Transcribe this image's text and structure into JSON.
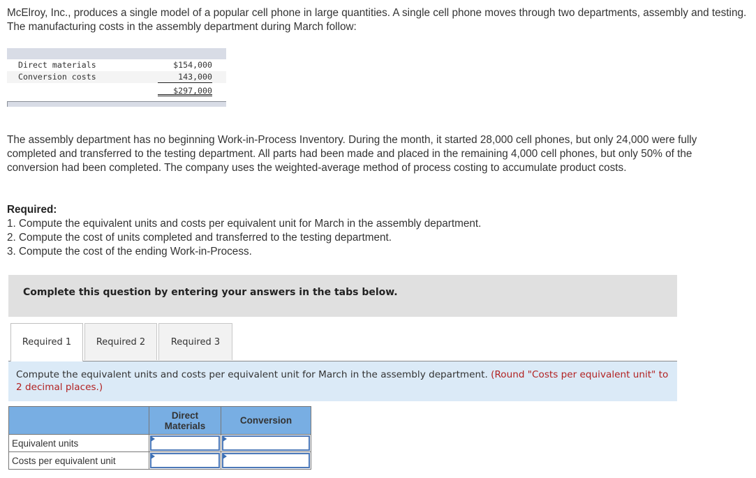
{
  "intro": {
    "text": "McElroy, Inc., produces a single model of a popular cell phone in large quantities. A single cell phone moves through two departments, assembly and testing. The manufacturing costs in the assembly department during March follow:"
  },
  "cost_table": {
    "rows": [
      {
        "label": "Direct materials",
        "value": "$154,000"
      },
      {
        "label": "Conversion costs",
        "value": "143,000"
      }
    ],
    "total": "$297,000"
  },
  "paragraph2": {
    "text": "The assembly department has no beginning Work-in-Process Inventory. During the month, it started 28,000 cell phones, but only 24,000 were fully completed and transferred to the testing department. All parts had been made and placed in the remaining 4,000 cell phones, but only 50% of the conversion had been completed. The company uses the weighted-average method of process costing to accumulate product costs."
  },
  "required": {
    "title": "Required:",
    "items": [
      "1. Compute the equivalent units and costs per equivalent unit for March in the assembly department.",
      "2. Compute the cost of units completed and transferred to the testing department.",
      "3. Compute the cost of the ending Work-in-Process."
    ]
  },
  "banner": {
    "text": "Complete this question by entering your answers in the tabs below."
  },
  "tabs": [
    {
      "label": "Required 1",
      "active": true
    },
    {
      "label": "Required 2",
      "active": false
    },
    {
      "label": "Required 3",
      "active": false
    }
  ],
  "instruction": {
    "text": "Compute the equivalent units and costs per equivalent unit for March in the assembly department.",
    "note": "(Round \"Costs per equivalent unit\" to 2 decimal places.)"
  },
  "answer_table": {
    "headers": [
      "",
      "Direct Materials",
      "Conversion"
    ],
    "rows": [
      {
        "label": "Equivalent units",
        "direct_materials": "",
        "conversion": ""
      },
      {
        "label": "Costs per equivalent unit",
        "direct_materials": "",
        "conversion": ""
      }
    ]
  }
}
